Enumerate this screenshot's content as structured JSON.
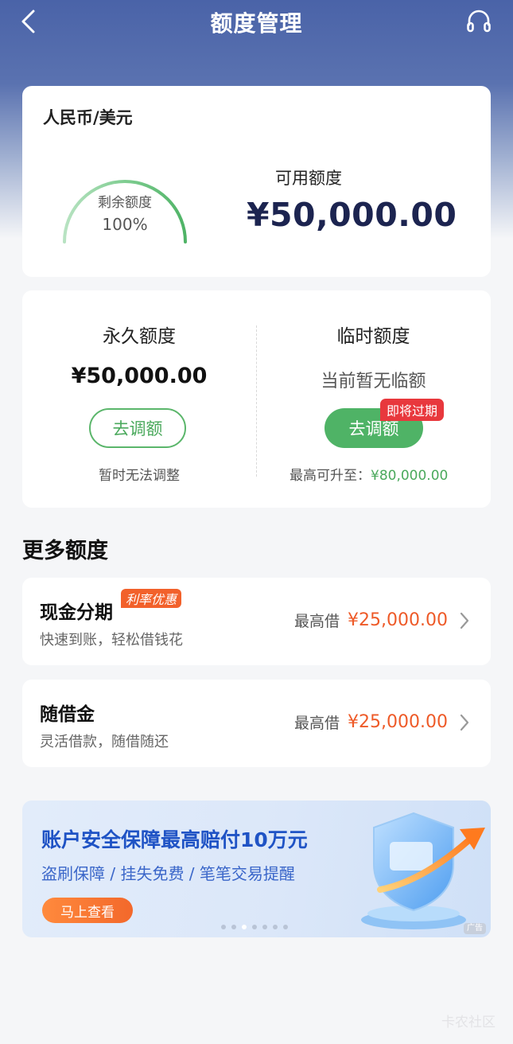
{
  "header": {
    "title": "额度管理",
    "back_icon": "chevron-left-icon",
    "support_icon": "headset-icon"
  },
  "summary": {
    "currency": "人民币/美元",
    "remaining_label": "剩余额度",
    "remaining_percent": "100%",
    "remaining_fraction": 1.0,
    "available_label": "可用额度",
    "available_amount": "¥50,000.00"
  },
  "limits": {
    "permanent": {
      "title": "永久额度",
      "amount": "¥50,000.00",
      "button": "去调额",
      "note": "暂时无法调整"
    },
    "temporary": {
      "title": "临时额度",
      "status": "当前暂无临额",
      "button": "去调额",
      "badge": "即将过期",
      "note_prefix": "最高可升至：",
      "note_value": "¥80,000.00"
    }
  },
  "more": {
    "title": "更多额度",
    "items": [
      {
        "title": "现金分期",
        "badge": "利率优惠",
        "subtitle": "快速到账，轻松借钱花",
        "max_label": "最高借",
        "max_value": "¥25,000.00"
      },
      {
        "title": "随借金",
        "subtitle": "灵活借款，随借随还",
        "max_label": "最高借",
        "max_value": "¥25,000.00"
      }
    ]
  },
  "banner": {
    "title": "账户安全保障最高赔付10万元",
    "subtitle": "盗刷保障 / 挂失免费 / 笔笔交易提醒",
    "button": "马上查看",
    "ad_tag": "广告",
    "dots_total": 7,
    "dots_active_index": 2
  },
  "watermark": "卡农社区",
  "colors": {
    "header_blue": "#4a63a8",
    "green": "#4fb366",
    "orange": "#ee5a28",
    "red_badge": "#e8383d",
    "navy": "#1c2450",
    "banner_blue": "#1f53c5"
  }
}
